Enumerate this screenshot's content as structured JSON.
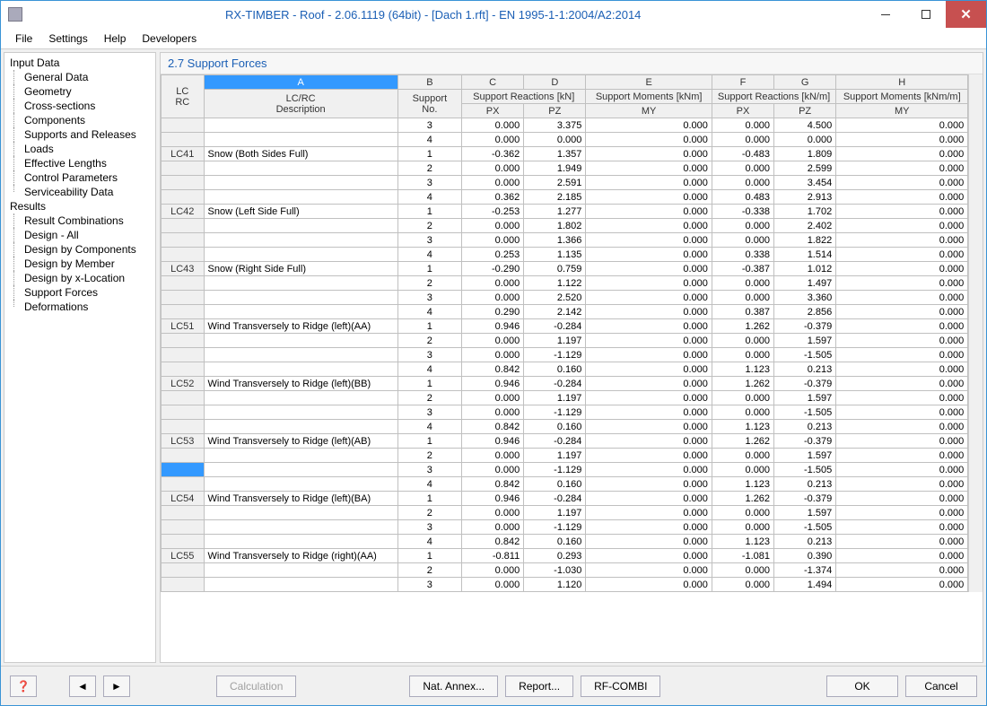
{
  "title": "RX-TIMBER - Roof - 2.06.1119 (64bit) - [Dach 1.rft] - EN 1995-1-1:2004/A2:2014",
  "menu": {
    "file": "File",
    "settings": "Settings",
    "help": "Help",
    "developers": "Developers"
  },
  "nav": {
    "s1": "Input Data",
    "s1i": [
      "General Data",
      "Geometry",
      "Cross-sections",
      "Components",
      "Supports and Releases",
      "Loads",
      "Effective Lengths",
      "Control Parameters",
      "Serviceability Data"
    ],
    "s2": "Results",
    "s2i": [
      "Result Combinations",
      "Design - All",
      "Design by Components",
      "Design by Member",
      "Design by x-Location",
      "Support Forces",
      "Deformations"
    ]
  },
  "content_title": "2.7 Support Forces",
  "cols": {
    "letters": [
      "A",
      "B",
      "C",
      "D",
      "E",
      "F",
      "G",
      "H"
    ],
    "rc": "LC\nRC",
    "a": "LC/RC\nDescription",
    "b": "Support\nNo.",
    "cd": "Support Reactions [kN]",
    "c": "PX",
    "d": "PZ",
    "e": "Support Moments [kNm]",
    "e2": "MY",
    "fg": "Support Reactions [kN/m]",
    "f": "PX",
    "g": "PZ",
    "h": "Support Moments [kNm/m]",
    "h2": "MY"
  },
  "rows": [
    {
      "rc": "",
      "desc": "",
      "sup": "3",
      "px": "0.000",
      "pz": "3.375",
      "my": "0.000",
      "px2": "0.000",
      "pz2": "4.500",
      "my2": "0.000"
    },
    {
      "rc": "",
      "desc": "",
      "sup": "4",
      "px": "0.000",
      "pz": "0.000",
      "my": "0.000",
      "px2": "0.000",
      "pz2": "0.000",
      "my2": "0.000"
    },
    {
      "rc": "LC41",
      "desc": "Snow (Both Sides Full)",
      "sup": "1",
      "px": "-0.362",
      "pz": "1.357",
      "my": "0.000",
      "px2": "-0.483",
      "pz2": "1.809",
      "my2": "0.000"
    },
    {
      "rc": "",
      "desc": "",
      "sup": "2",
      "px": "0.000",
      "pz": "1.949",
      "my": "0.000",
      "px2": "0.000",
      "pz2": "2.599",
      "my2": "0.000"
    },
    {
      "rc": "",
      "desc": "",
      "sup": "3",
      "px": "0.000",
      "pz": "2.591",
      "my": "0.000",
      "px2": "0.000",
      "pz2": "3.454",
      "my2": "0.000"
    },
    {
      "rc": "",
      "desc": "",
      "sup": "4",
      "px": "0.362",
      "pz": "2.185",
      "my": "0.000",
      "px2": "0.483",
      "pz2": "2.913",
      "my2": "0.000"
    },
    {
      "rc": "LC42",
      "desc": "Snow (Left Side Full)",
      "sup": "1",
      "px": "-0.253",
      "pz": "1.277",
      "my": "0.000",
      "px2": "-0.338",
      "pz2": "1.702",
      "my2": "0.000"
    },
    {
      "rc": "",
      "desc": "",
      "sup": "2",
      "px": "0.000",
      "pz": "1.802",
      "my": "0.000",
      "px2": "0.000",
      "pz2": "2.402",
      "my2": "0.000"
    },
    {
      "rc": "",
      "desc": "",
      "sup": "3",
      "px": "0.000",
      "pz": "1.366",
      "my": "0.000",
      "px2": "0.000",
      "pz2": "1.822",
      "my2": "0.000"
    },
    {
      "rc": "",
      "desc": "",
      "sup": "4",
      "px": "0.253",
      "pz": "1.135",
      "my": "0.000",
      "px2": "0.338",
      "pz2": "1.514",
      "my2": "0.000"
    },
    {
      "rc": "LC43",
      "desc": "Snow (Right Side Full)",
      "sup": "1",
      "px": "-0.290",
      "pz": "0.759",
      "my": "0.000",
      "px2": "-0.387",
      "pz2": "1.012",
      "my2": "0.000"
    },
    {
      "rc": "",
      "desc": "",
      "sup": "2",
      "px": "0.000",
      "pz": "1.122",
      "my": "0.000",
      "px2": "0.000",
      "pz2": "1.497",
      "my2": "0.000"
    },
    {
      "rc": "",
      "desc": "",
      "sup": "3",
      "px": "0.000",
      "pz": "2.520",
      "my": "0.000",
      "px2": "0.000",
      "pz2": "3.360",
      "my2": "0.000"
    },
    {
      "rc": "",
      "desc": "",
      "sup": "4",
      "px": "0.290",
      "pz": "2.142",
      "my": "0.000",
      "px2": "0.387",
      "pz2": "2.856",
      "my2": "0.000"
    },
    {
      "rc": "LC51",
      "desc": "Wind Transversely to Ridge (left)(AA)",
      "sup": "1",
      "px": "0.946",
      "pz": "-0.284",
      "my": "0.000",
      "px2": "1.262",
      "pz2": "-0.379",
      "my2": "0.000"
    },
    {
      "rc": "",
      "desc": "",
      "sup": "2",
      "px": "0.000",
      "pz": "1.197",
      "my": "0.000",
      "px2": "0.000",
      "pz2": "1.597",
      "my2": "0.000"
    },
    {
      "rc": "",
      "desc": "",
      "sup": "3",
      "px": "0.000",
      "pz": "-1.129",
      "my": "0.000",
      "px2": "0.000",
      "pz2": "-1.505",
      "my2": "0.000"
    },
    {
      "rc": "",
      "desc": "",
      "sup": "4",
      "px": "0.842",
      "pz": "0.160",
      "my": "0.000",
      "px2": "1.123",
      "pz2": "0.213",
      "my2": "0.000"
    },
    {
      "rc": "LC52",
      "desc": "Wind Transversely to Ridge (left)(BB)",
      "sup": "1",
      "px": "0.946",
      "pz": "-0.284",
      "my": "0.000",
      "px2": "1.262",
      "pz2": "-0.379",
      "my2": "0.000"
    },
    {
      "rc": "",
      "desc": "",
      "sup": "2",
      "px": "0.000",
      "pz": "1.197",
      "my": "0.000",
      "px2": "0.000",
      "pz2": "1.597",
      "my2": "0.000"
    },
    {
      "rc": "",
      "desc": "",
      "sup": "3",
      "px": "0.000",
      "pz": "-1.129",
      "my": "0.000",
      "px2": "0.000",
      "pz2": "-1.505",
      "my2": "0.000"
    },
    {
      "rc": "",
      "desc": "",
      "sup": "4",
      "px": "0.842",
      "pz": "0.160",
      "my": "0.000",
      "px2": "1.123",
      "pz2": "0.213",
      "my2": "0.000"
    },
    {
      "rc": "LC53",
      "desc": "Wind Transversely to Ridge (left)(AB)",
      "sup": "1",
      "px": "0.946",
      "pz": "-0.284",
      "my": "0.000",
      "px2": "1.262",
      "pz2": "-0.379",
      "my2": "0.000"
    },
    {
      "rc": "",
      "desc": "",
      "sup": "2",
      "px": "0.000",
      "pz": "1.197",
      "my": "0.000",
      "px2": "0.000",
      "pz2": "1.597",
      "my2": "0.000"
    },
    {
      "rc": "",
      "desc": "",
      "sup": "3",
      "px": "0.000",
      "pz": "-1.129",
      "my": "0.000",
      "px2": "0.000",
      "pz2": "-1.505",
      "my2": "0.000",
      "sel": true
    },
    {
      "rc": "",
      "desc": "",
      "sup": "4",
      "px": "0.842",
      "pz": "0.160",
      "my": "0.000",
      "px2": "1.123",
      "pz2": "0.213",
      "my2": "0.000"
    },
    {
      "rc": "LC54",
      "desc": "Wind Transversely to Ridge (left)(BA)",
      "sup": "1",
      "px": "0.946",
      "pz": "-0.284",
      "my": "0.000",
      "px2": "1.262",
      "pz2": "-0.379",
      "my2": "0.000"
    },
    {
      "rc": "",
      "desc": "",
      "sup": "2",
      "px": "0.000",
      "pz": "1.197",
      "my": "0.000",
      "px2": "0.000",
      "pz2": "1.597",
      "my2": "0.000"
    },
    {
      "rc": "",
      "desc": "",
      "sup": "3",
      "px": "0.000",
      "pz": "-1.129",
      "my": "0.000",
      "px2": "0.000",
      "pz2": "-1.505",
      "my2": "0.000"
    },
    {
      "rc": "",
      "desc": "",
      "sup": "4",
      "px": "0.842",
      "pz": "0.160",
      "my": "0.000",
      "px2": "1.123",
      "pz2": "0.213",
      "my2": "0.000"
    },
    {
      "rc": "LC55",
      "desc": "Wind Transversely to Ridge (right)(AA)",
      "sup": "1",
      "px": "-0.811",
      "pz": "0.293",
      "my": "0.000",
      "px2": "-1.081",
      "pz2": "0.390",
      "my2": "0.000"
    },
    {
      "rc": "",
      "desc": "",
      "sup": "2",
      "px": "0.000",
      "pz": "-1.030",
      "my": "0.000",
      "px2": "0.000",
      "pz2": "-1.374",
      "my2": "0.000"
    },
    {
      "rc": "",
      "desc": "",
      "sup": "3",
      "px": "0.000",
      "pz": "1.120",
      "my": "0.000",
      "px2": "0.000",
      "pz2": "1.494",
      "my2": "0.000"
    }
  ],
  "buttons": {
    "calc": "Calculation",
    "annex": "Nat. Annex...",
    "report": "Report...",
    "combi": "RF-COMBI",
    "ok": "OK",
    "cancel": "Cancel"
  }
}
